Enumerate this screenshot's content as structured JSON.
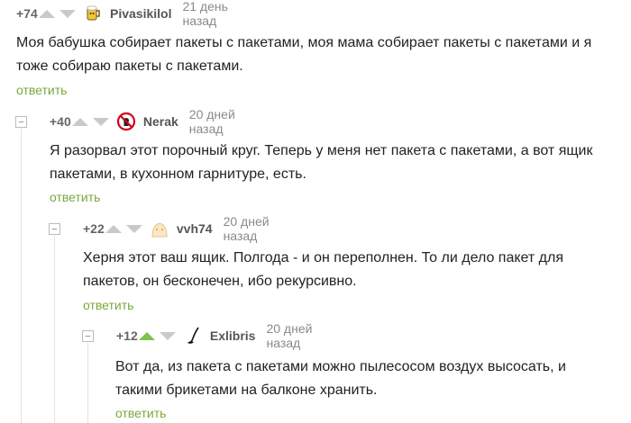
{
  "comments": [
    {
      "rating": "+74",
      "nick": "Pivasikilol",
      "time": "21 день назад",
      "text": "Моя бабушка собирает пакеты с пакетами, моя мама собирает пакеты с пакетами и я тоже собираю пакеты с пакетами.",
      "reply": "ответить",
      "avatar_icon": "beer-avatar-icon",
      "upvoted": false
    },
    {
      "rating": "+40",
      "nick": "Nerak",
      "time": "20 дней назад",
      "text": "Я разорвал этот порочный круг. Теперь у меня нет пакета с пакетами, а вот ящик пакетами, в кухонном гарнитуре, есть.",
      "reply": "ответить",
      "avatar_icon": "no-sign-avatar-icon",
      "upvoted": false
    },
    {
      "rating": "+22",
      "nick": "vvh74",
      "time": "20 дней назад",
      "text": "Херня этот ваш ящик. Полгода - и он переполнен. То ли дело пакет для пакетов, он бесконечен, ибо рекурсивно.",
      "reply": "ответить",
      "avatar_icon": "blank-avatar-icon",
      "upvoted": false
    },
    {
      "rating": "+12",
      "nick": "Exlibris",
      "time": "20 дней назад",
      "text": "Вот да, из пакета с пакетами можно пылесосом воздух высосать, и такими брикетами на балконе хранить.",
      "reply": "ответить",
      "avatar_icon": "quill-avatar-icon",
      "upvoted": true
    }
  ]
}
